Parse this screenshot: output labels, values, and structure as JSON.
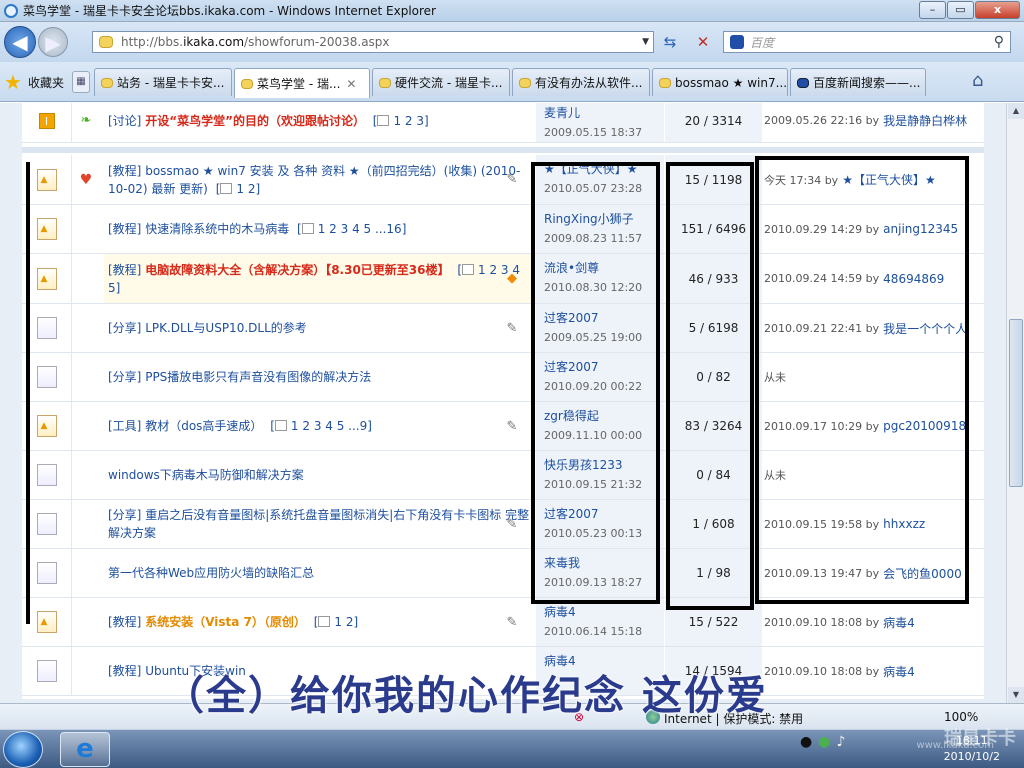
{
  "window": {
    "title": "菜鸟学堂 - 瑞星卡卡安全论坛bbs.ikaka.com - Windows Internet Explorer",
    "controls": [
      "–",
      "▭",
      "x"
    ]
  },
  "nav": {
    "url_prefix": "http://bbs.",
    "url_host": "ikaka.com",
    "url_path": "/showforum-20038.aspx",
    "search_placeholder": "百度"
  },
  "favorites_label": "收藏夹",
  "tabs": [
    {
      "label": "站务 - 瑞星卡卡安...",
      "active": false
    },
    {
      "label": "菜鸟学堂 - 瑞...",
      "active": true
    },
    {
      "label": "硬件交流 - 瑞星卡...",
      "active": false
    },
    {
      "label": "有没有办法从软件...",
      "active": false
    },
    {
      "label": "bossmao ★ win7...",
      "active": false
    },
    {
      "label": "百度新闻搜索——...",
      "active": false
    }
  ],
  "threads": [
    {
      "cat": "[讨论]",
      "title": "开设“菜鸟学堂”的目的（欢迎跟帖讨论）",
      "style": "red",
      "pages": "1 2 3",
      "author": "麦青儿",
      "date": "2009.05.15 18:37",
      "count": "20 / 3314",
      "last_time": "2009.05.26 22:16 by",
      "last_by": "我是静静白桦林"
    },
    {
      "cat": "[教程]",
      "title": "bossmao ★ win7 安装 及 各种 资料 ★（前四招完结）(收集) (2010-10-02) 最新 更新)",
      "style": "normal",
      "pages": "1 2",
      "author": "★【正气大侠】★",
      "date": "2010.05.07 23:28",
      "count": "15 / 1198",
      "last_time": "今天 17:34 by",
      "last_by": "★【正气大侠】★"
    },
    {
      "cat": "[教程]",
      "title": "快速清除系统中的木马病毒",
      "style": "normal",
      "pages": "1 2 3 4 5 ...16",
      "author": "RingXing小狮子",
      "date": "2009.08.23 11:57",
      "count": "151 / 6496",
      "last_time": "2010.09.29 14:29 by",
      "last_by": "anjing12345"
    },
    {
      "cat": "[教程]",
      "title": "电脑故障资料大全（含解决方案）【8.30已更新至36楼】",
      "style": "red",
      "pages": "1 2 3 4 5",
      "author": "流浪•剑尊",
      "date": "2010.08.30 12:20",
      "count": "46 / 933",
      "last_time": "2010.09.24 14:59 by",
      "last_by": "48694869"
    },
    {
      "cat": "[分享]",
      "title": "LPK.DLL与USP10.DLL的参考",
      "style": "normal",
      "pages": "",
      "author": "过客2007",
      "date": "2009.05.25 19:00",
      "count": "5 / 6198",
      "last_time": "2010.09.21 22:41 by",
      "last_by": "我是一个个个人"
    },
    {
      "cat": "[分享]",
      "title": "PPS播放电影只有声音没有图像的解决方法",
      "style": "normal",
      "pages": "",
      "author": "过客2007",
      "date": "2010.09.20 00:22",
      "count": "0 / 82",
      "last_time": "从未",
      "last_by": ""
    },
    {
      "cat": "[工具]",
      "title": "教材（dos高手速成）",
      "style": "normal",
      "pages": "1 2 3 4 5 ...9",
      "author": "zgr稳得起",
      "date": "2009.11.10 00:00",
      "count": "83 / 3264",
      "last_time": "2010.09.17 10:29 by",
      "last_by": "pgc20100918"
    },
    {
      "cat": "",
      "title": "windows下病毒木马防御和解决方案",
      "style": "normal",
      "pages": "",
      "author": "快乐男孩1233",
      "date": "2010.09.15 21:32",
      "count": "0 / 84",
      "last_time": "从未",
      "last_by": ""
    },
    {
      "cat": "[分享]",
      "title": "重启之后没有音量图标|系统托盘音量图标消失|右下角没有卡卡图标 完整解决方案",
      "style": "normal",
      "pages": "",
      "author": "过客2007",
      "date": "2010.05.23 00:13",
      "count": "1 / 608",
      "last_time": "2010.09.15 19:58 by",
      "last_by": "hhxxzz"
    },
    {
      "cat": "",
      "title": "第一代各种Web应用防火墙的缺陷汇总",
      "style": "normal",
      "pages": "",
      "author": "来毒我",
      "date": "2010.09.13 18:27",
      "count": "1 / 98",
      "last_time": "2010.09.13 19:47 by",
      "last_by": "会飞的鱼0000"
    },
    {
      "cat": "[教程]",
      "title": "系统安装（Vista 7）（原创）",
      "style": "orange",
      "pages": "1 2",
      "author": "病毒4",
      "date": "2010.06.14 15:18",
      "count": "15 / 522",
      "last_time": "2010.09.10 18:08 by",
      "last_by": "病毒4"
    },
    {
      "cat": "[教程]",
      "title": "Ubuntu下安装win",
      "style": "normal",
      "pages": "",
      "author": "病毒4",
      "date": "",
      "count": "14 / 1594",
      "last_time": "2010.09.10 18:08 by",
      "last_by": "病毒4"
    }
  ],
  "status": {
    "zone": "Internet | 保护模式: 禁用",
    "zoom": "100%"
  },
  "caption": "（全）给你我的心作纪念  这份爱",
  "taskbar": {
    "time": "18:11",
    "date": "2010/10/2",
    "watermark": "瑞星卡卡",
    "watermark_url": "www.ikaka.com"
  }
}
